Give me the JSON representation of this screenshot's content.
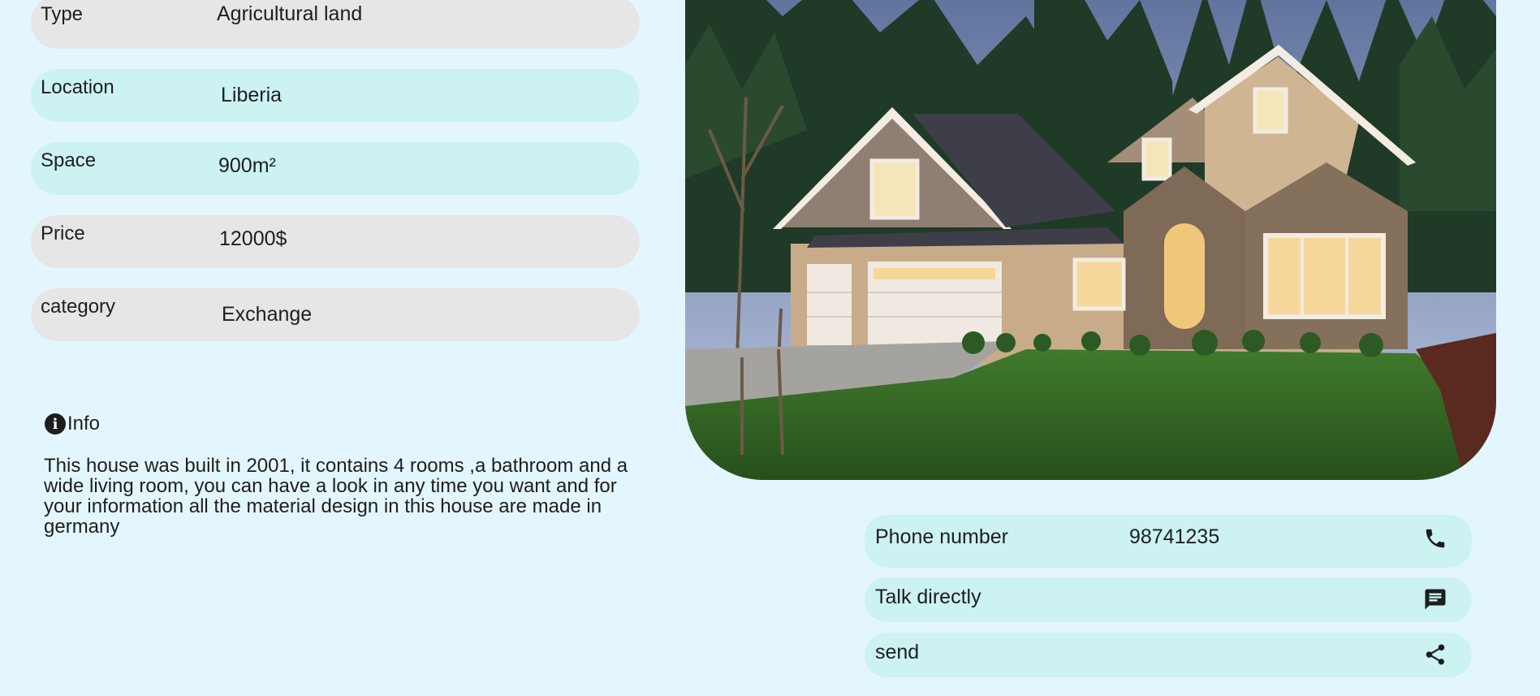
{
  "details": [
    {
      "label": "Type",
      "value": "Agricultural land"
    },
    {
      "label": "Location",
      "value": "Liberia"
    },
    {
      "label": "Space",
      "value": "900m²"
    },
    {
      "label": "Price",
      "value": "12000$"
    },
    {
      "label": "category",
      "value": "Exchange"
    }
  ],
  "info": {
    "title": "Info",
    "icon": "info-icon",
    "text": "This house was built in 2001, it contains 4 rooms ,a bathroom and a wide living room, you can have a look in any time you want and for your information all the material design in this house are made in germany"
  },
  "contact": {
    "phone_label": "Phone number",
    "phone_value": "98741235",
    "phone_icon": "phone-icon",
    "talk_label": "Talk directly",
    "talk_icon": "chat-icon",
    "send_label": "send",
    "send_icon": "share-icon"
  },
  "colors": {
    "background": "#e4f6fd",
    "pill_grey": "#e6e6e6",
    "pill_teal": "#ccf2f2",
    "text": "#1e1e1e"
  }
}
